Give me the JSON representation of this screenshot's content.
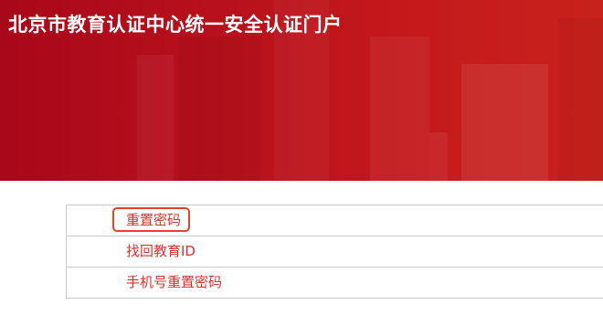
{
  "header": {
    "title": "北京市教育认证中心统一安全认证门户"
  },
  "menu": {
    "items": [
      {
        "label": "重置密码",
        "highlighted": true
      },
      {
        "label": "找回教育ID",
        "highlighted": false
      },
      {
        "label": "手机号重置密码",
        "highlighted": false
      }
    ]
  },
  "colors": {
    "banner": "#b8101c",
    "link": "#e0312c",
    "highlight_border": "#e8402a"
  }
}
